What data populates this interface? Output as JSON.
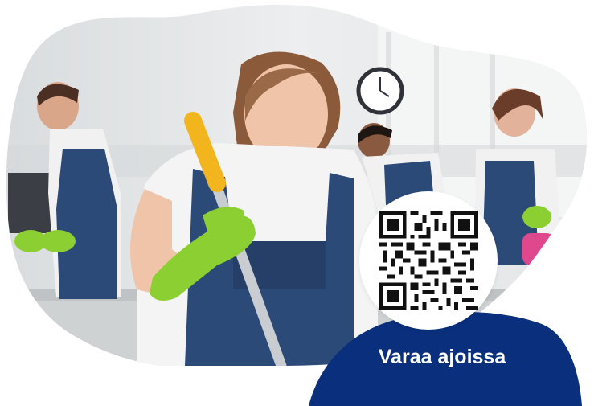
{
  "hero": {
    "image_icon": "cleaning-staff-photo"
  },
  "qr": {
    "icon": "qr-code-icon"
  },
  "cta": {
    "text": "Varaa ajoissa",
    "color": "#0a2f7d"
  },
  "colors": {
    "accent_blue": "#0a2f7d",
    "glove_green": "#8ccf32",
    "apron_blue": "#2c4a78",
    "mop_yellow": "#f2b51e"
  }
}
